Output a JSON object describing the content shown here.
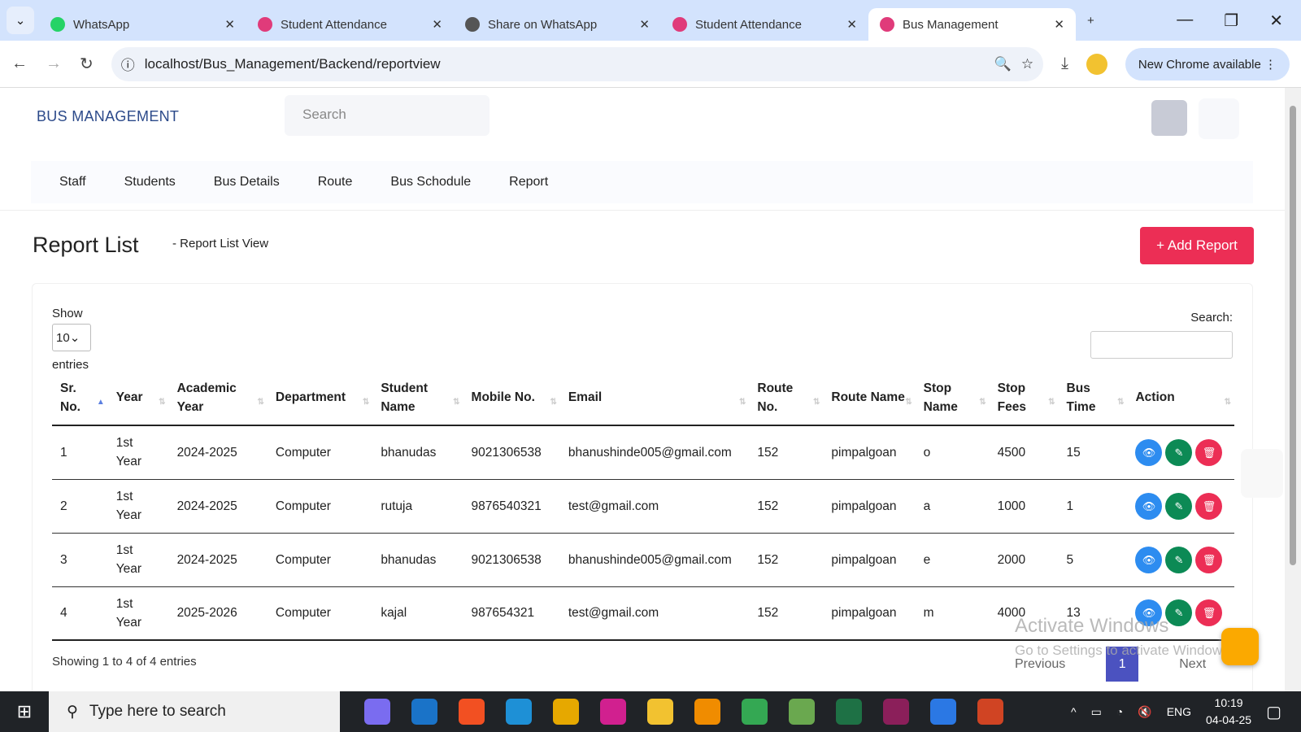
{
  "browser": {
    "tabs": [
      {
        "title": "WhatsApp",
        "color": "#25d366"
      },
      {
        "title": "Student Attendance",
        "color": "#e03b7a"
      },
      {
        "title": "Share on WhatsApp",
        "color": "#555"
      },
      {
        "title": "Student Attendance",
        "color": "#e03b7a"
      },
      {
        "title": "Bus Management",
        "color": "#e03b7a",
        "active": true
      }
    ],
    "url": "localhost/Bus_Management/Backend/reportview",
    "update_label": "New Chrome available"
  },
  "header": {
    "brand": "BUS MANAGEMENT",
    "search_placeholder": "Search"
  },
  "menu": [
    "Staff",
    "Students",
    "Bus Details",
    "Route",
    "Bus Schodule",
    "Report"
  ],
  "page": {
    "title": "Report List",
    "breadcrumb": "-  Report List View",
    "add_button": "+ Add Report"
  },
  "table_controls": {
    "show": "Show",
    "entries_value": "10",
    "entries": "entries",
    "search_label": "Search:"
  },
  "table": {
    "columns": [
      "Sr. No.",
      "Year",
      "Academic Year",
      "Department",
      "Student Name",
      "Mobile No.",
      "Email",
      "Route No.",
      "Route Name",
      "Stop Name",
      "Stop Fees",
      "Bus Time",
      "Action"
    ],
    "rows": [
      [
        "1",
        "1st Year",
        "2024-2025",
        "Computer",
        "bhanudas",
        "9021306538",
        "bhanushinde005@gmail.com",
        "152",
        "pimpalgoan",
        "o",
        "4500",
        "15"
      ],
      [
        "2",
        "1st Year",
        "2024-2025",
        "Computer",
        "rutuja",
        "9876540321",
        "test@gmail.com",
        "152",
        "pimpalgoan",
        "a",
        "1000",
        "1"
      ],
      [
        "3",
        "1st Year",
        "2024-2025",
        "Computer",
        "bhanudas",
        "9021306538",
        "bhanushinde005@gmail.com",
        "152",
        "pimpalgoan",
        "e",
        "2000",
        "5"
      ],
      [
        "4",
        "1st Year",
        "2025-2026",
        "Computer",
        "kajal",
        "987654321",
        "test@gmail.com",
        "152",
        "pimpalgoan",
        "m",
        "4000",
        "13"
      ]
    ],
    "action_colors": {
      "view": "#2d8cf0",
      "edit": "#0c8a55",
      "delete": "#ec2e55"
    }
  },
  "footer": {
    "info": "Showing 1 to 4 of 4 entries",
    "previous": "Previous",
    "page": "1",
    "next": "Next"
  },
  "watermark": {
    "line1": "Activate Windows",
    "line2": "Go to Settings to activate Windows."
  },
  "taskbar": {
    "search_placeholder": "Type here to search",
    "lang": "ENG",
    "time": "10:19",
    "date": "04-04-25"
  }
}
